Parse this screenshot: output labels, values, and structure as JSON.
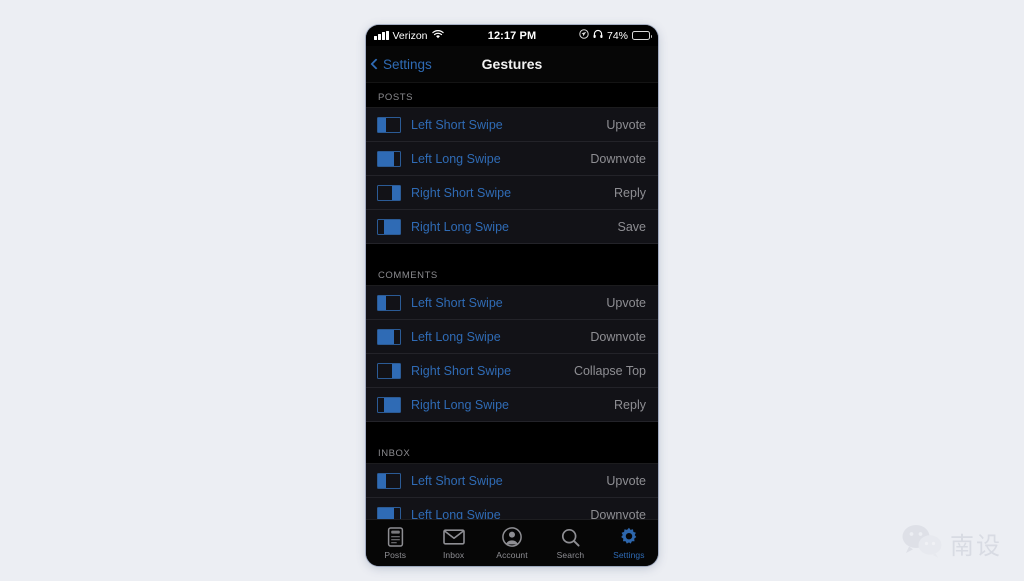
{
  "statusbar": {
    "carrier": "Verizon",
    "time": "12:17 PM",
    "battery_percent": "74%",
    "signal_icon": "signal-bars-icon",
    "wifi_icon": "wifi-icon",
    "location_icon": "location-arrow-icon",
    "headphones_icon": "headphones-icon",
    "battery_icon": "battery-icon"
  },
  "navbar": {
    "back_label": "Settings",
    "back_icon": "chevron-left-icon",
    "title": "Gestures"
  },
  "sections": [
    {
      "header": "POSTS",
      "rows": [
        {
          "icon": "left-short",
          "label": "Left Short Swipe",
          "value": "Upvote"
        },
        {
          "icon": "left-long",
          "label": "Left Long Swipe",
          "value": "Downvote"
        },
        {
          "icon": "right-short",
          "label": "Right Short Swipe",
          "value": "Reply"
        },
        {
          "icon": "right-long",
          "label": "Right Long Swipe",
          "value": "Save"
        }
      ]
    },
    {
      "header": "COMMENTS",
      "rows": [
        {
          "icon": "left-short",
          "label": "Left Short Swipe",
          "value": "Upvote"
        },
        {
          "icon": "left-long",
          "label": "Left Long Swipe",
          "value": "Downvote"
        },
        {
          "icon": "right-short",
          "label": "Right Short Swipe",
          "value": "Collapse Top"
        },
        {
          "icon": "right-long",
          "label": "Right Long Swipe",
          "value": "Reply"
        }
      ]
    },
    {
      "header": "INBOX",
      "rows": [
        {
          "icon": "left-short",
          "label": "Left Short Swipe",
          "value": "Upvote"
        },
        {
          "icon": "left-long",
          "label": "Left Long Swipe",
          "value": "Downvote"
        }
      ]
    }
  ],
  "tabbar": {
    "tabs": [
      {
        "label": "Posts",
        "icon": "posts-icon",
        "active": false
      },
      {
        "label": "Inbox",
        "icon": "envelope-icon",
        "active": false
      },
      {
        "label": "Account",
        "icon": "account-icon",
        "active": false
      },
      {
        "label": "Search",
        "icon": "search-icon",
        "active": false
      },
      {
        "label": "Settings",
        "icon": "gear-icon",
        "active": true
      }
    ]
  },
  "watermark": {
    "logo_icon": "wechat-logo-icon",
    "text": "南设"
  },
  "colors": {
    "accent_blue": "#2f6bb5",
    "value_gray": "#8e8e93",
    "row_bg": "#121217",
    "page_bg": "#000000",
    "outer_bg": "#eceef3"
  }
}
